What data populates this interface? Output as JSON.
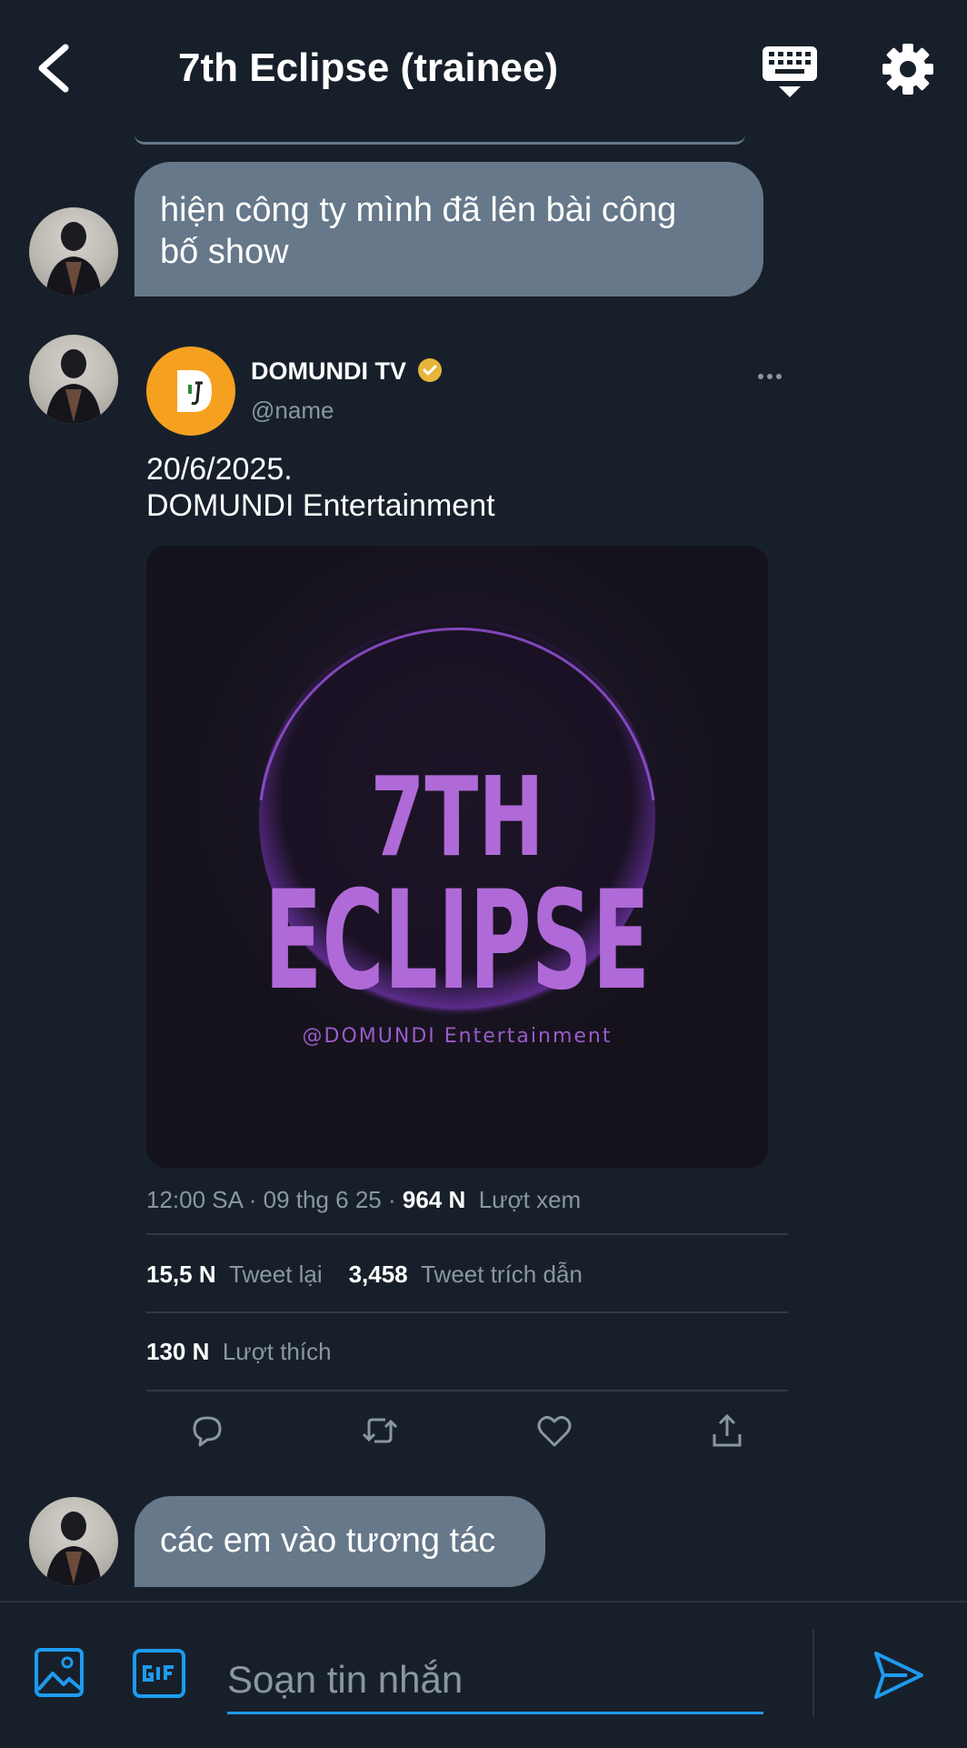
{
  "header": {
    "title": "7th Eclipse (trainee)"
  },
  "messages": {
    "bubble1_lines": [
      "hiện công ty mình đã lên bài công",
      "bố show"
    ],
    "bubble3": "các em vào tương tác"
  },
  "tweet": {
    "name": "DOMUNDI TV",
    "handle": "@name",
    "text_lines": [
      "20/6/2025.",
      "DOMUNDI Entertainment"
    ],
    "image": {
      "line1": "7TH",
      "line2": "ECLIPSE",
      "credit": "@DOMUNDI Entertainment"
    },
    "meta_time": "12:00 SA · 09 thg 6 25 · ",
    "views_count": "964 N",
    "views_label": "Lượt xem",
    "retweets_count": "15,5 N",
    "retweets_label": "Tweet lại",
    "quotes_count": "3,458",
    "quotes_label": "Tweet trích dẫn",
    "likes_count": "130 N",
    "likes_label": "Lượt thích"
  },
  "composer": {
    "placeholder": "Soạn tin nhắn"
  },
  "colors": {
    "background": "#17202a",
    "bubble": "#66788a",
    "accent": "#1d9bf0",
    "muted": "#8a96a3"
  },
  "icons": [
    "back-arrow-icon",
    "keyboard-icon",
    "gear-icon",
    "verified-badge-icon",
    "more-icon",
    "reply-icon",
    "retweet-icon",
    "like-icon",
    "share-icon",
    "image-icon",
    "gif-icon",
    "send-icon"
  ]
}
